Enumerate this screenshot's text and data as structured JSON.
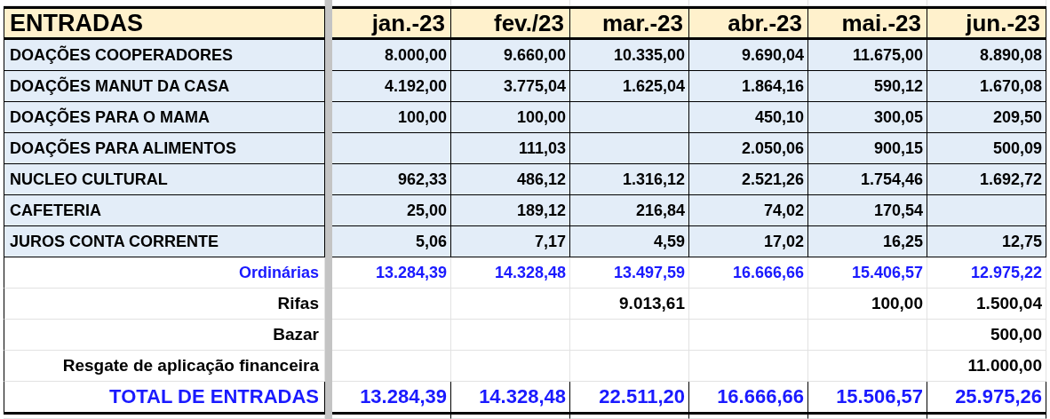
{
  "header": {
    "title": "ENTRADAS",
    "months": [
      "jan.-23",
      "fev./23",
      "mar.-23",
      "abr.-23",
      "mai.-23",
      "jun.-23"
    ]
  },
  "rows": [
    {
      "kind": "category",
      "label": "DOAÇÕES COOPERADORES",
      "cells": {
        "jan": "8.000,00",
        "fev": "9.660,00",
        "mar": "10.335,00",
        "abr": "9.690,04",
        "mai": "11.675,00",
        "jun": "8.890,08"
      }
    },
    {
      "kind": "category",
      "label": "DOAÇÕES MANUT DA CASA",
      "cells": {
        "jan": "4.192,00",
        "fev": "3.775,04",
        "mar": "1.625,04",
        "abr": "1.864,16",
        "mai": "590,12",
        "jun": "1.670,08"
      }
    },
    {
      "kind": "category",
      "label": "DOAÇÕES PARA O MAMA",
      "cells": {
        "jan": "100,00",
        "fev": "100,00",
        "abr": "450,10",
        "mai": "300,05",
        "jun": "209,50"
      }
    },
    {
      "kind": "category",
      "label": "DOAÇÕES PARA ALIMENTOS",
      "cells": {
        "fev": "111,03",
        "abr": "2.050,06",
        "mai": "900,15",
        "jun": "500,09"
      }
    },
    {
      "kind": "category",
      "label": "NUCLEO CULTURAL",
      "cells": {
        "jan": "962,33",
        "fev": "486,12",
        "mar": "1.316,12",
        "abr": "2.521,26",
        "mai": "1.754,46",
        "jun": "1.692,72"
      }
    },
    {
      "kind": "category",
      "label": "CAFETERIA",
      "cells": {
        "jan": "25,00",
        "fev": "189,12",
        "mar": "216,84",
        "abr": "74,02",
        "mai": "170,54"
      }
    },
    {
      "kind": "category",
      "label": "JUROS CONTA CORRENTE",
      "cells": {
        "jan": "5,06",
        "fev": "7,17",
        "mar": "4,59",
        "abr": "17,02",
        "mai": "16,25",
        "jun": "12,75"
      }
    },
    {
      "kind": "subtotal",
      "label": "Ordinárias",
      "cells": {
        "jan": "13.284,39",
        "fev": "14.328,48",
        "mar": "13.497,59",
        "abr": "16.666,66",
        "mai": "15.406,57",
        "jun": "12.975,22"
      }
    },
    {
      "kind": "extra",
      "label": "Rifas",
      "cells": {
        "mar": "9.013,61",
        "mai": "100,00",
        "jun": "1.500,04"
      }
    },
    {
      "kind": "extra",
      "label": "Bazar",
      "cells": {
        "jun": "500,00"
      }
    },
    {
      "kind": "extra",
      "label": "Resgate de aplicação financeira",
      "cells": {
        "jun": "11.000,00"
      }
    },
    {
      "kind": "total",
      "label": "TOTAL DE ENTRADAS",
      "cells": {
        "jan": "13.284,39",
        "fev": "14.328,48",
        "mar": "22.511,20",
        "abr": "16.666,66",
        "mai": "15.506,57",
        "jun": "25.975,26"
      }
    }
  ]
}
